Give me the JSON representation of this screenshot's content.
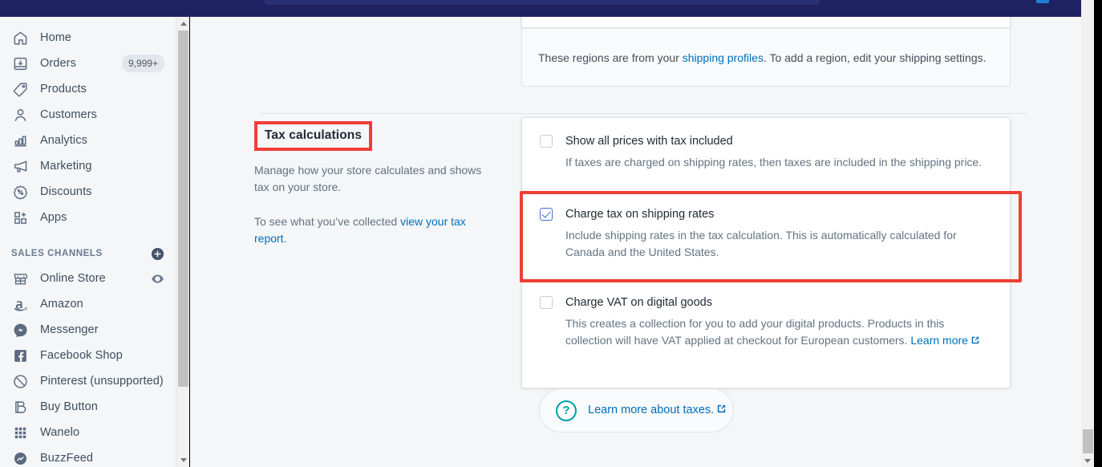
{
  "topbar": {
    "search_placeholder": ""
  },
  "sidebar": {
    "items": [
      {
        "label": "Home",
        "icon": "home-icon",
        "badge": ""
      },
      {
        "label": "Orders",
        "icon": "orders-inbox-icon",
        "badge": "9,999+"
      },
      {
        "label": "Products",
        "icon": "products-tag-icon",
        "badge": ""
      },
      {
        "label": "Customers",
        "icon": "customers-person-icon",
        "badge": ""
      },
      {
        "label": "Analytics",
        "icon": "analytics-bars-icon",
        "badge": ""
      },
      {
        "label": "Marketing",
        "icon": "marketing-megaphone-icon",
        "badge": ""
      },
      {
        "label": "Discounts",
        "icon": "discounts-percent-icon",
        "badge": ""
      },
      {
        "label": "Apps",
        "icon": "apps-grid-plus-icon",
        "badge": ""
      }
    ],
    "section_title": "SALES CHANNELS",
    "section_add_icon": "add-circle-icon",
    "channels": [
      {
        "label": "Online Store",
        "icon": "online-store-icon",
        "right_icon": "eye-icon"
      },
      {
        "label": "Amazon",
        "icon": "amazon-icon",
        "right_icon": ""
      },
      {
        "label": "Messenger",
        "icon": "messenger-icon",
        "right_icon": ""
      },
      {
        "label": "Facebook Shop",
        "icon": "facebook-icon",
        "right_icon": ""
      },
      {
        "label": "Pinterest (unsupported)",
        "icon": "pinterest-disabled-icon",
        "right_icon": ""
      },
      {
        "label": "Buy Button",
        "icon": "buy-button-icon",
        "right_icon": ""
      },
      {
        "label": "Wanelo",
        "icon": "wanelo-grid-icon",
        "right_icon": ""
      },
      {
        "label": "BuzzFeed",
        "icon": "buzzfeed-icon",
        "right_icon": ""
      }
    ]
  },
  "main": {
    "regions_note": {
      "text_before": "These regions are from your ",
      "link": "shipping profiles",
      "text_after": ". To add a region, edit your shipping settings."
    },
    "section": {
      "title": "Tax calculations",
      "desc1": "Manage how your store calculates and shows tax on your store.",
      "desc2_before": "To see what you’ve collected ",
      "desc2_link": "view your tax report",
      "desc2_after": "."
    },
    "options": [
      {
        "title": "Show all prices with tax included",
        "desc": "If taxes are charged on shipping rates, then taxes are included in the shipping price.",
        "checked": false,
        "highlighted": false,
        "learn_more": ""
      },
      {
        "title": "Charge tax on shipping rates",
        "desc": "Include shipping rates in the tax calculation. This is automatically calculated for Canada and the United States.",
        "checked": true,
        "highlighted": true,
        "learn_more": ""
      },
      {
        "title": "Charge VAT on digital goods",
        "desc": "This creates a collection for you to add your digital products. Products in this collection will have VAT applied at checkout for European customers. ",
        "checked": false,
        "highlighted": false,
        "learn_more": "Learn more"
      }
    ],
    "help_banner": {
      "icon": "question-circle-icon",
      "label": "Learn more about taxes.",
      "external_icon": "external-link-icon"
    }
  },
  "colors": {
    "topbar_navy": "#1f2260",
    "highlight_red": "#ef3e36",
    "link_blue": "#006fbb",
    "checkbox_blue": "#3f6ed0",
    "help_teal": "#00a0ac",
    "page_bg": "#f4f6f8"
  }
}
